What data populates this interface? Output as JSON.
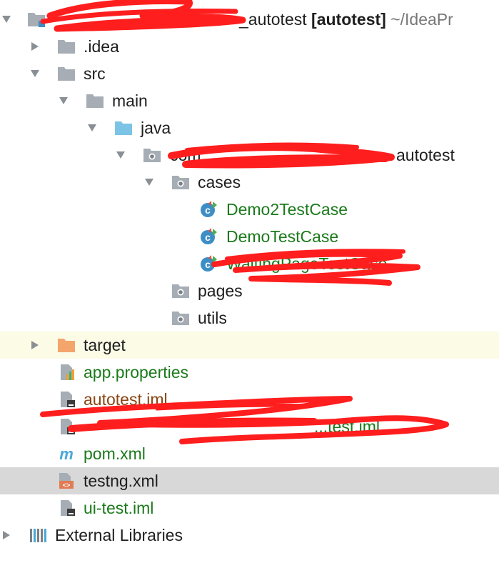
{
  "colors": {
    "folder": "#a6adb4",
    "source_folder": "#7cc4e6",
    "excluded_folder": "#f4a56b",
    "package_dot": "#7a8086",
    "class_circle": "#3d8ec4",
    "test_marker_green": "#4caf50",
    "test_marker_red": "#e74c3c",
    "scribble": "#ff1e1e",
    "selection_gray": "#d8d8d8",
    "selection_yellow": "#fcfbe6"
  },
  "tree": {
    "root": {
      "name_suffix": "_autotest",
      "module": "[autotest]",
      "path": "~/IdeaPr",
      "icon": "module-folder-icon"
    },
    "idea": {
      "label": ".idea",
      "icon": "folder-icon"
    },
    "src": {
      "label": "src",
      "icon": "folder-icon"
    },
    "main": {
      "label": "main",
      "icon": "folder-icon"
    },
    "java": {
      "label": "java",
      "icon": "source-folder-icon"
    },
    "package": {
      "prefix": "com",
      "suffix": "autotest",
      "icon": "package-icon"
    },
    "cases": {
      "label": "cases",
      "icon": "package-icon"
    },
    "class1": {
      "label": "Demo2TestCase",
      "icon": "test-class-icon"
    },
    "class2": {
      "label": "DemoTestCase",
      "icon": "test-class-icon"
    },
    "class3": {
      "label": "WaitingPageTestCase",
      "icon": "test-class-icon"
    },
    "pages": {
      "label": "pages",
      "icon": "package-icon"
    },
    "utils": {
      "label": "utils",
      "icon": "package-icon"
    },
    "target": {
      "label": "target",
      "icon": "excluded-folder-icon"
    },
    "app_properties": {
      "label": "app.properties",
      "icon": "properties-file-icon"
    },
    "autotest_iml": {
      "label": "autotest.iml",
      "icon": "iml-file-icon"
    },
    "hidden_iml": {
      "label": "...test.iml",
      "icon": "iml-file-icon"
    },
    "pom": {
      "label": "pom.xml",
      "icon": "maven-icon"
    },
    "testng": {
      "label": "testng.xml",
      "icon": "xml-file-icon"
    },
    "ui_test_iml": {
      "label": "ui-test.iml",
      "icon": "iml-file-icon"
    },
    "external_libraries": {
      "label": "External Libraries",
      "icon": "libraries-icon"
    }
  }
}
